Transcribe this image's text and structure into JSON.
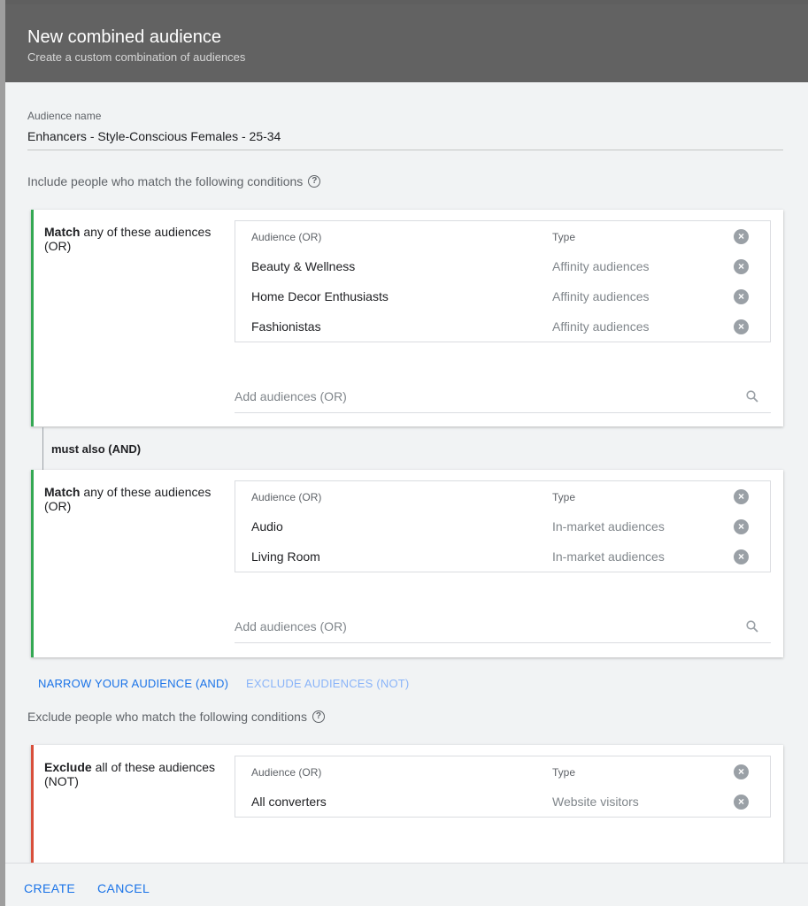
{
  "dialog": {
    "title": "New combined audience",
    "subtitle": "Create a custom combination of audiences"
  },
  "audience_name": {
    "label": "Audience name",
    "value": "Enhancers - Style-Conscious Females - 25-34"
  },
  "include_heading": "Include people who match the following conditions",
  "exclude_heading": "Exclude people who match the following conditions",
  "help_icon_glyph": "?",
  "groups": [
    {
      "label_bold": "Match",
      "label_rest": " any of these audiences (OR)",
      "header": {
        "name": "Audience (OR)",
        "type": "Type"
      },
      "rows": [
        {
          "name": "Beauty & Wellness",
          "type": "Affinity audiences"
        },
        {
          "name": "Home Decor Enthusiasts",
          "type": "Affinity audiences"
        },
        {
          "name": "Fashionistas",
          "type": "Affinity audiences"
        }
      ],
      "add_placeholder": "Add audiences (OR)"
    },
    {
      "label_bold": "Match",
      "label_rest": " any of these audiences (OR)",
      "header": {
        "name": "Audience (OR)",
        "type": "Type"
      },
      "rows": [
        {
          "name": "Audio",
          "type": "In-market audiences"
        },
        {
          "name": "Living Room",
          "type": "In-market audiences"
        }
      ],
      "add_placeholder": "Add audiences (OR)"
    }
  ],
  "and_label": "must also (AND)",
  "actions": {
    "narrow": "NARROW YOUR AUDIENCE (AND)",
    "exclude": "EXCLUDE AUDIENCES (NOT)"
  },
  "exclude_group": {
    "label_bold": "Exclude",
    "label_rest": " all of these audiences (NOT)",
    "header": {
      "name": "Audience (OR)",
      "type": "Type"
    },
    "rows": [
      {
        "name": "All converters",
        "type": "Website visitors"
      }
    ]
  },
  "footer": {
    "create": "CREATE",
    "cancel": "CANCEL"
  },
  "icons": {
    "remove": "close-circle-icon",
    "search": "search-icon",
    "help": "help-circle-icon"
  },
  "colors": {
    "accent": "#1a73e8",
    "include_border": "#34a853",
    "exclude_border": "#d84f3b",
    "header_bg": "#626262"
  }
}
